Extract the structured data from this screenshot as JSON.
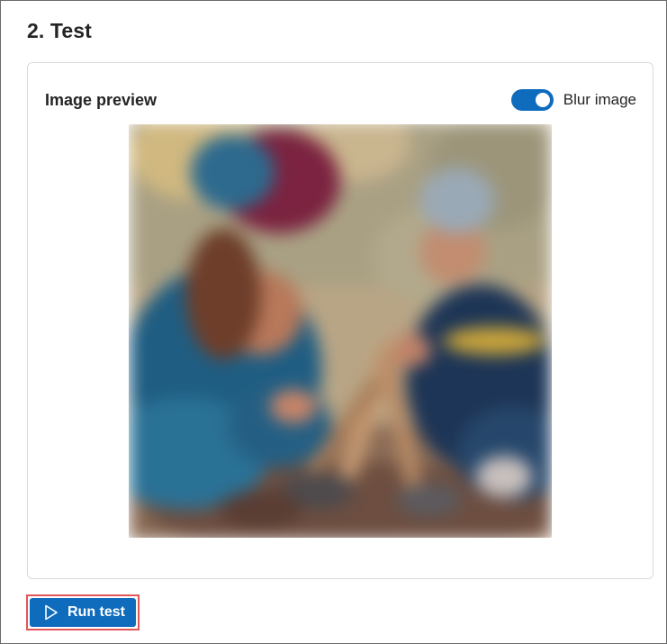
{
  "section": {
    "title": "2. Test"
  },
  "preview": {
    "title": "Image preview",
    "blur_toggle": {
      "label": "Blur image",
      "state": "on",
      "color": "#0f6cbd"
    },
    "image": {
      "blurred": true,
      "icon": "image-preview"
    }
  },
  "actions": {
    "run_test_label": "Run test",
    "run_test_icon": "play-icon",
    "accent": "#0f6cbd",
    "highlight": "#e05659"
  }
}
